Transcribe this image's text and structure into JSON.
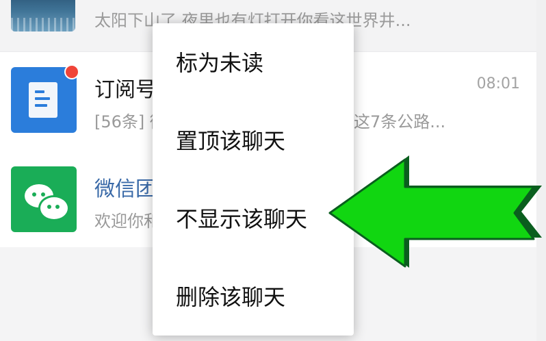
{
  "chats": [
    {
      "name": "",
      "preview": "太阳下山了 夜里也有灯打开你看这世界井...",
      "time": ""
    },
    {
      "name": "订阅号",
      "preview": "[56条] 微",
      "preview_tail": "这7条公路...",
      "time": "08:01",
      "avatar_icon": "document-icon",
      "unread": true
    },
    {
      "name": "微信团",
      "preview": "欢迎你和",
      "time": "",
      "avatar_icon": "wechat-bubbles-icon"
    }
  ],
  "context_menu": {
    "items": [
      {
        "label": "标为未读"
      },
      {
        "label": "置顶该聊天"
      },
      {
        "label": "不显示该聊天"
      },
      {
        "label": "删除该聊天"
      }
    ]
  },
  "annotation": {
    "icon": "left-arrow-icon",
    "fill": "#11d611",
    "stroke": "#0a5e1e"
  },
  "colors": {
    "wechat_green": "#1aad57",
    "subscription_blue": "#2b7ddb",
    "badge_red": "#f04438"
  }
}
